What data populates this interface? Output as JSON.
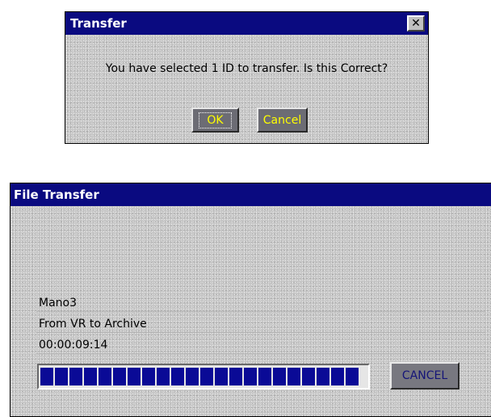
{
  "confirm_dialog": {
    "title": "Transfer",
    "close_glyph": "✕",
    "message": "You have selected 1 ID to transfer. Is this Correct?",
    "ok_label": "OK",
    "cancel_label": "Cancel"
  },
  "transfer_dialog": {
    "title": "File Transfer",
    "item_name": "Mano3",
    "route": "From VR to Archive",
    "timecode": "00:00:09:14",
    "progress_fraction": 0.98,
    "cancel_label": "CANCEL"
  },
  "colors": {
    "titlebar": "#0a0a80",
    "progress_segment": "#0a0a96",
    "button_text_yellow": "#ffff00",
    "cancel_text_blue": "#141478"
  },
  "icons": {
    "close": "close-icon"
  }
}
